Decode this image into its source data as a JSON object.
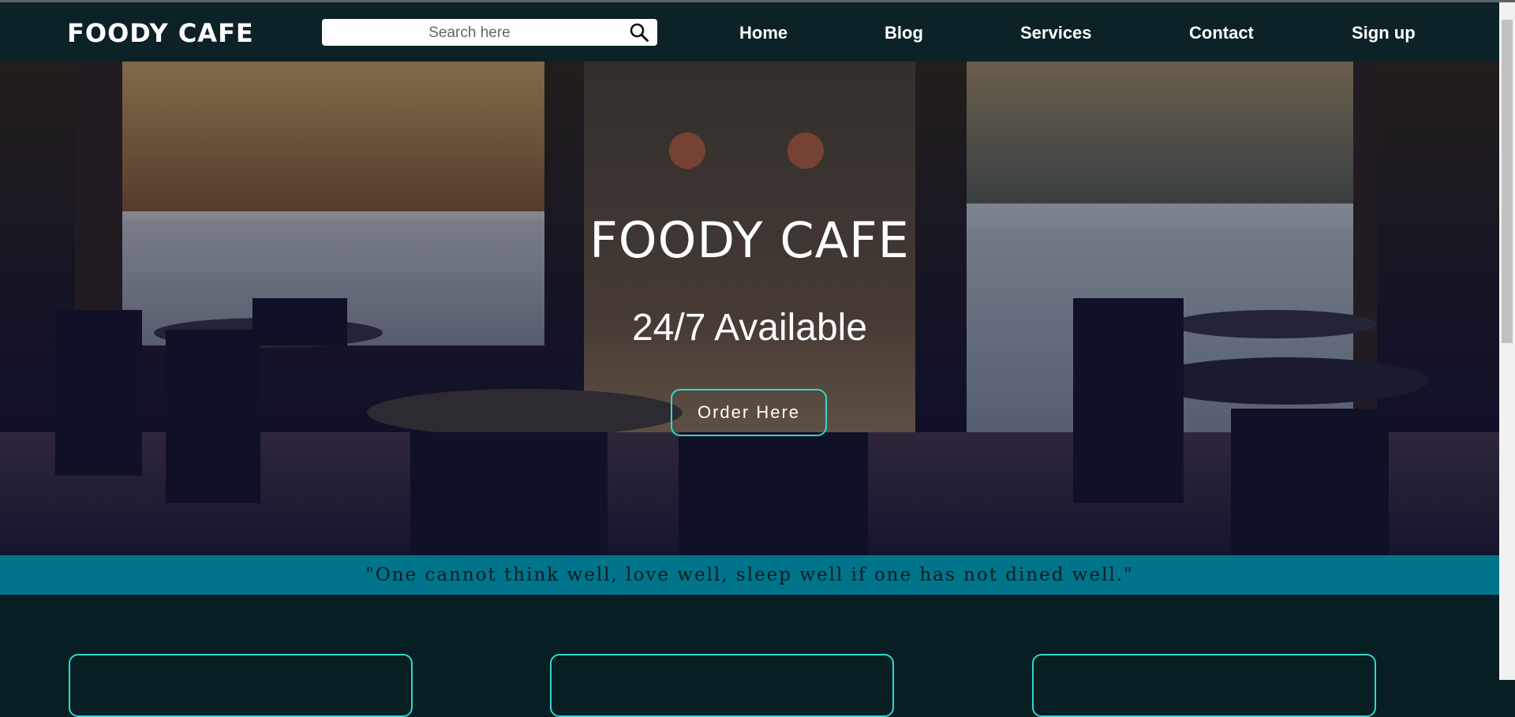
{
  "header": {
    "brand": "FOODY CAFE",
    "search_placeholder": "Search here",
    "nav": [
      {
        "label": "Home"
      },
      {
        "label": "Blog"
      },
      {
        "label": "Services"
      },
      {
        "label": "Contact"
      },
      {
        "label": "Sign up"
      }
    ]
  },
  "hero": {
    "title": "FOODY CAFE",
    "subtitle": "24/7 Available",
    "cta_label": "Order Here"
  },
  "quote": "\"One cannot think well, love well, sleep well if one has not dined well.\"",
  "colors": {
    "nav_bg": "#0c2226",
    "accent": "#2ed8d0",
    "quote_band": "#00748a",
    "page_bg": "#071e22"
  }
}
